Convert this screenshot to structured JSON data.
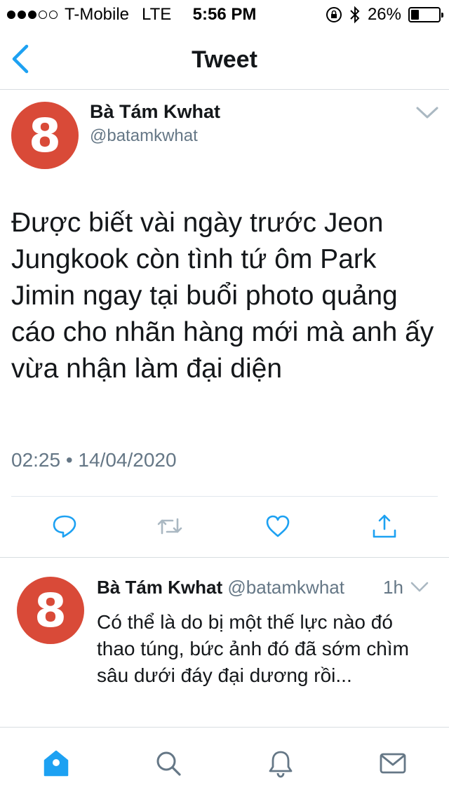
{
  "status_bar": {
    "carrier": "T-Mobile",
    "network": "LTE",
    "time": "5:56 PM",
    "battery": "26%",
    "battery_level": 0.26,
    "signal_bars_filled": 3,
    "signal_bars_total": 5
  },
  "nav": {
    "title": "Tweet",
    "back_icon": "chevron-left-icon"
  },
  "tweet": {
    "avatar_text": "8",
    "avatar_color": "#d94a38",
    "author_name": "Bà Tám Kwhat",
    "handle": "@batamkwhat",
    "text": "Được biết vài ngày trước Jeon Jungkook còn tình tứ ôm Park Jimin ngay tại buổi photo quảng cáo cho nhãn hàng mới mà anh ấy vừa nhận làm đại diện",
    "timestamp": "02:25 • 14/04/2020",
    "actions": [
      "reply-icon",
      "retweet-icon",
      "like-icon",
      "share-icon"
    ]
  },
  "reply": {
    "avatar_text": "8",
    "author_name": "Bà Tám Kwhat",
    "handle": "@batamkwhat",
    "time": "1h",
    "text": "Có thể là do bị  một thế lực nào đó thao túng, bức ảnh đó đã sớm chìm sâu dưới đáy đại dương rồi..."
  },
  "tabbar": {
    "tabs": [
      "home-icon",
      "search-icon",
      "notifications-icon",
      "messages-icon"
    ],
    "active_tab": "home-icon"
  },
  "colors": {
    "accent": "#1da1f2",
    "muted": "#657786",
    "icon_gray": "#657786"
  }
}
